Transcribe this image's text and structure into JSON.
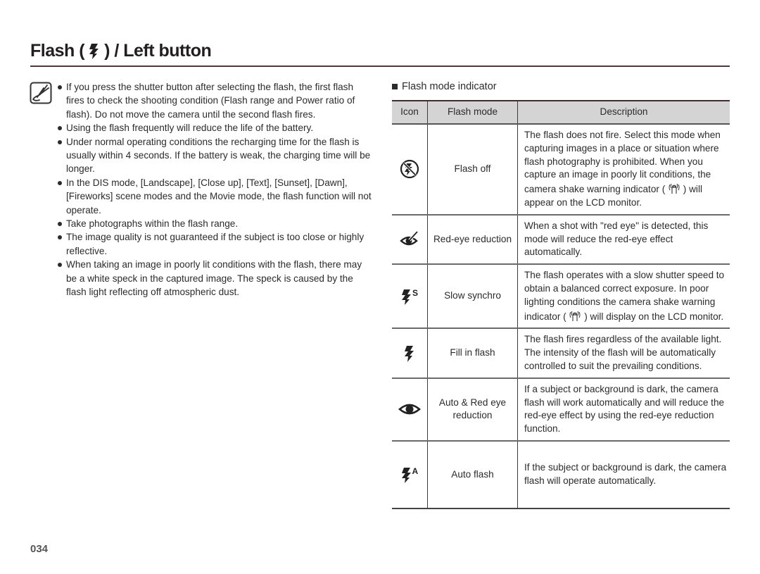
{
  "header": {
    "title_prefix": "Flash (",
    "title_icon": "flash-icon",
    "title_suffix": ") / Left button"
  },
  "notes": {
    "icon": "note-pencil-icon",
    "items": [
      "If you press the shutter button after selecting the flash, the first flash fires to check the shooting condition (Flash range and Power ratio of flash). Do not move the camera until the second flash fires.",
      "Using the flash frequently will reduce the life of the battery.",
      "Under normal operating conditions the recharging time for the flash is usually within 4 seconds. If the battery is weak, the charging time will be longer.",
      "In the DIS mode, [Landscape], [Close up], [Text], [Sunset], [Dawn], [Fireworks] scene modes and the Movie mode, the flash function will not operate.",
      "Take photographs within the flash range.",
      "The image quality is not guaranteed if the subject is too close or highly reflective.",
      "When taking an image in poorly lit conditions with the flash, there may be a white speck in the captured image. The speck is caused by the flash light reflecting off atmospheric dust."
    ]
  },
  "flash_table": {
    "section_title": "Flash mode indicator",
    "columns": [
      "Icon",
      "Flash mode",
      "Description"
    ],
    "rows": [
      {
        "icon": "flash-off-icon",
        "mode": "Flash off",
        "desc_before": "The flash does not fire. Select this mode when capturing images in a place or situation where flash photography is prohibited. When you capture an image in poorly lit conditions, the camera shake warning indicator (",
        "desc_icon": "camera-shake-icon",
        "desc_after": ") will appear on the LCD monitor."
      },
      {
        "icon": "red-eye-reduction-icon",
        "mode": "Red-eye reduction",
        "desc_before": "When a shot with \"red eye\" is detected, this mode will reduce the red-eye effect automatically.",
        "desc_icon": "",
        "desc_after": ""
      },
      {
        "icon": "slow-synchro-icon",
        "mode": "Slow synchro",
        "desc_before": "The flash operates with a slow shutter speed to obtain a balanced correct exposure. In poor lighting conditions the camera shake warning indicator (",
        "desc_icon": "camera-shake-icon",
        "desc_after": ") will display on the LCD monitor."
      },
      {
        "icon": "fill-in-flash-icon",
        "mode": "Fill in flash",
        "desc_before": "The flash fires regardless of the available light. The intensity of the flash will be automatically controlled to suit the prevailing conditions.",
        "desc_icon": "",
        "desc_after": ""
      },
      {
        "icon": "auto-red-eye-icon",
        "mode": "Auto & Red eye reduction",
        "desc_before": "If a subject or background is dark, the camera flash will work automatically and will reduce the red-eye effect by using the red-eye reduction function.",
        "desc_icon": "",
        "desc_after": ""
      },
      {
        "icon": "auto-flash-icon",
        "mode": "Auto flash",
        "desc_before": "If the subject or background is dark, the camera flash will operate automatically.",
        "desc_icon": "",
        "desc_after": ""
      }
    ]
  },
  "footer": {
    "page_number": "034"
  }
}
